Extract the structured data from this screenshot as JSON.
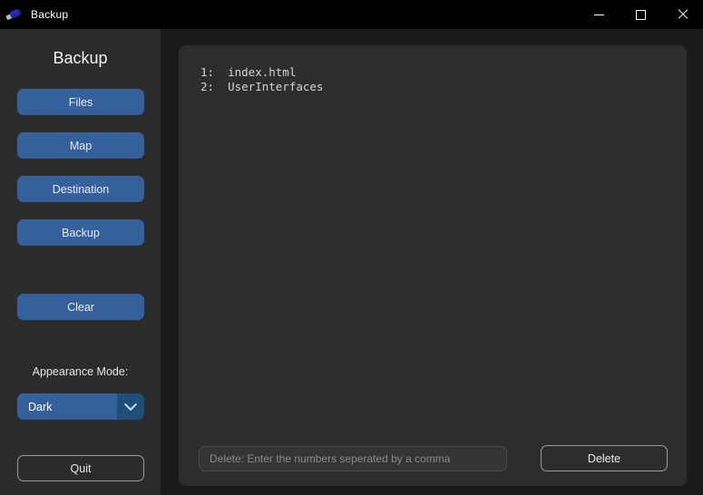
{
  "window": {
    "title": "Backup",
    "icon": "usb-drive-icon",
    "controls": {
      "minimize": "minimize-icon",
      "maximize": "maximize-icon",
      "close": "close-icon"
    }
  },
  "theme": {
    "accent_blue": "#36609c",
    "accent_blue_dark": "#1f4e79",
    "sidebar_bg": "#2b2b2b",
    "panel_bg": "#2d2d2d",
    "window_bg": "#1a1a1a",
    "titlebar_bg": "#000000",
    "text_light": "#eaeaea",
    "mono_text": "#d5d5d5",
    "outline": "#9a9a9a"
  },
  "sidebar": {
    "heading": "Backup",
    "buttons": [
      {
        "label": "Files"
      },
      {
        "label": "Map"
      },
      {
        "label": "Destination"
      },
      {
        "label": "Backup"
      },
      {
        "label": "Clear"
      }
    ],
    "appearance": {
      "label": "Appearance Mode:",
      "selected": "Dark",
      "chevron": "chevron-down-icon"
    },
    "quit": {
      "label": "Quit"
    }
  },
  "main": {
    "entries": [
      {
        "index": "1:",
        "name": "index.html",
        "line": "1:  index.html"
      },
      {
        "index": "2:",
        "name": "UserInterfaces",
        "line": "2:  UserInterfaces"
      }
    ],
    "delete_input": {
      "placeholder": "Delete: Enter the numbers seperated by a comma",
      "value": ""
    },
    "delete_button": {
      "label": "Delete"
    }
  }
}
